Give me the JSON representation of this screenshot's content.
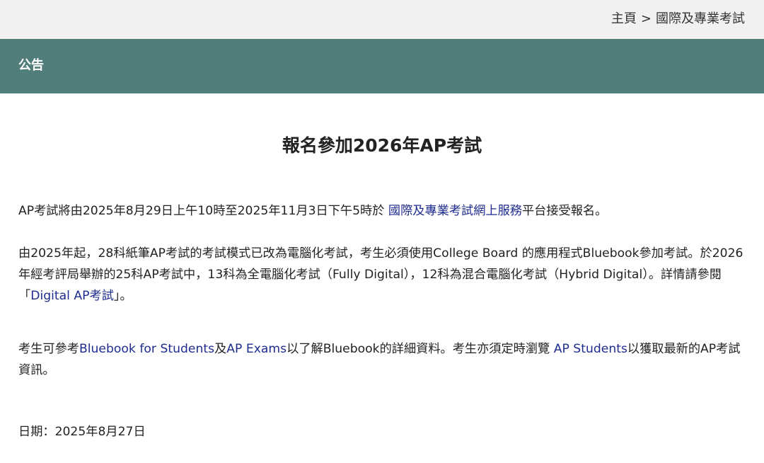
{
  "breadcrumb": {
    "home": "主頁",
    "separator": ">",
    "current": "國際及專業考試"
  },
  "section": {
    "title": "公告"
  },
  "article": {
    "title": "報名參加2026年AP考試",
    "p1": {
      "before": "AP考試將由2025年8月29日上午10時至2025年11月3日下午5時於 ",
      "link": "國際及專業考試網上服務",
      "after": "平台接受報名。"
    },
    "p2": {
      "before": "由2025年起，28科紙筆AP考試的考試模式已改為電腦化考試，考生必須使用College Board 的應用程式Bluebook參加考試。於2026年經考評局舉辦的25科AP考試中，13科為全電腦化考試（Fully Digital），12科為混合電腦化考試（Hybrid Digital）。詳情請參閱「",
      "link": "Digital AP考試",
      "after": "」。"
    },
    "p3": {
      "t1": "考生可參考",
      "link1": "Bluebook for Students",
      "t2": "及",
      "link2": "AP Exams",
      "t3": "以了解Bluebook的詳細資料。考生亦須定時瀏覽 ",
      "link3": "AP Students",
      "t4": "以獲取最新的AP考試資訊。"
    },
    "date": "日期：2025年8月27日"
  },
  "colors": {
    "header_bg": "#517e7b",
    "breadcrumb_bg": "#f1f1f1",
    "link": "#1f2c8f"
  }
}
